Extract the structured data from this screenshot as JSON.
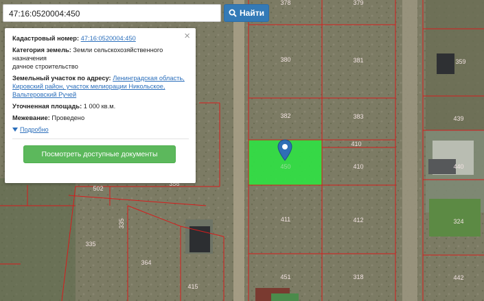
{
  "search": {
    "value": "47:16:0520004:450",
    "button_label": "Найти"
  },
  "popup": {
    "close_glyph": "×",
    "cadastral_label": "Кадастровый номер:",
    "cadastral_value": "47:16:0520004:450",
    "category_label": "Категория земель:",
    "category_value": "Земли сельскохозяйственного назначения",
    "category_value_2": "дачное строительство",
    "address_label": "Земельный участок по адресу:",
    "address_value": "Ленинградская область, Кировский район, участок мелиорации Никольское, Вальтеровский Ручей",
    "area_label": "Уточненная площадь:",
    "area_value": "1 000 кв.м.",
    "survey_label": "Межевание:",
    "survey_value": "Проведено",
    "more_label": "Подробно",
    "docs_button": "Посмотреть доступные документы"
  },
  "map": {
    "selected_fill": "#33dd44",
    "boundary_color": "#d81c1c",
    "plots": [
      {
        "id": "p378",
        "label": "378"
      },
      {
        "id": "p379",
        "label": "379"
      },
      {
        "id": "p380",
        "label": "380"
      },
      {
        "id": "p381",
        "label": "381"
      },
      {
        "id": "p382",
        "label": "382"
      },
      {
        "id": "p383",
        "label": "383"
      },
      {
        "id": "p410a",
        "label": "410"
      },
      {
        "id": "p410b",
        "label": "410"
      },
      {
        "id": "p450",
        "label": "450"
      },
      {
        "id": "p411",
        "label": "411"
      },
      {
        "id": "p412",
        "label": "412"
      },
      {
        "id": "p451",
        "label": "451"
      },
      {
        "id": "p318",
        "label": "318"
      },
      {
        "id": "p359",
        "label": "359"
      },
      {
        "id": "p439",
        "label": "439"
      },
      {
        "id": "p440",
        "label": "440"
      },
      {
        "id": "p324",
        "label": "324"
      },
      {
        "id": "p442",
        "label": "442"
      },
      {
        "id": "p502",
        "label": "502"
      },
      {
        "id": "p356",
        "label": "356"
      },
      {
        "id": "p335a",
        "label": "335"
      },
      {
        "id": "p335b",
        "label": "335"
      },
      {
        "id": "p364",
        "label": "364"
      },
      {
        "id": "p415",
        "label": "415"
      }
    ]
  }
}
